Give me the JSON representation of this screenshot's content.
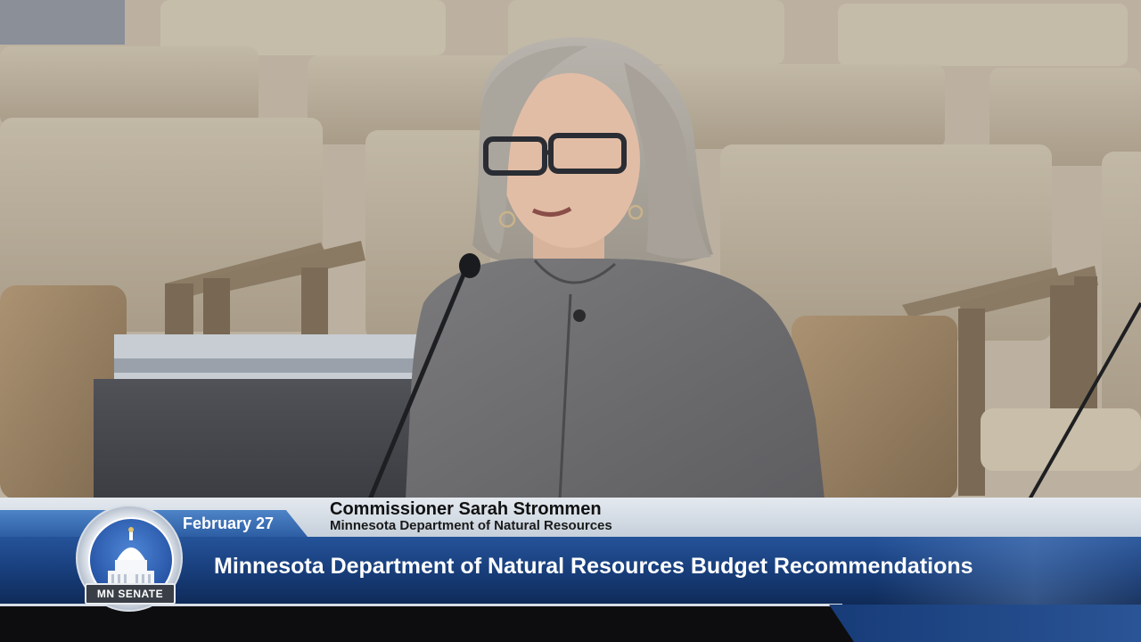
{
  "broadcast": {
    "date": "February 27",
    "speaker_name": "Commissioner Sarah Strommen",
    "speaker_org": "Minnesota Department of Natural Resources",
    "title": "Minnesota Department of Natural Resources Budget Recommendations",
    "logo_text": "MN SENATE"
  },
  "colors": {
    "bar_blue": "#173c78",
    "date_blue": "#2d5ea3",
    "name_bar": "#d5dce5",
    "chair_fabric": "#b4a995",
    "leather": "#9a8466"
  },
  "icons": {
    "seal": "capitol-dome-seal-icon",
    "microphone": "microphone-icon"
  }
}
